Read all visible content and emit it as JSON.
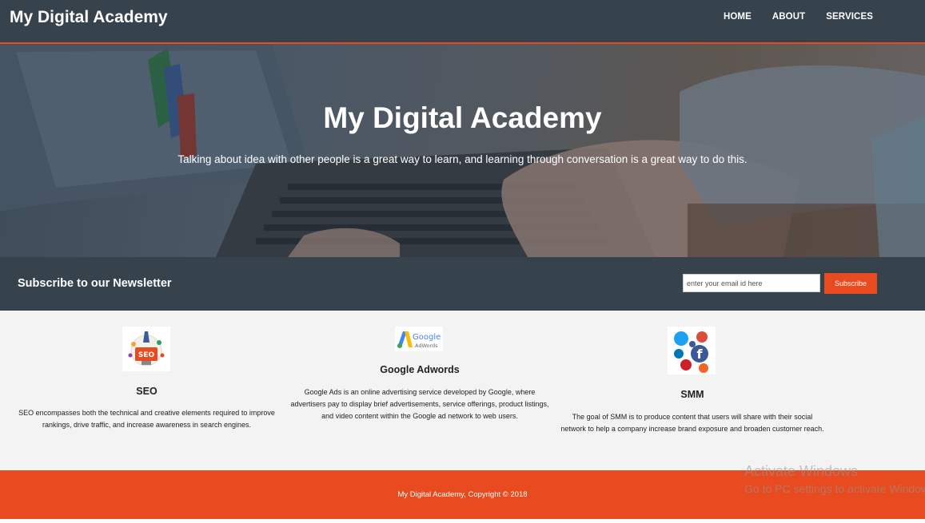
{
  "header": {
    "brand": "My Digital Academy",
    "nav": [
      "HOME",
      "ABOUT",
      "SERVICES"
    ]
  },
  "hero": {
    "title": "My Digital Academy",
    "subtitle": "Talking about idea with other people is a great way to learn, and learning through conversation is a great way to do this."
  },
  "newsletter": {
    "title": "Subscribe to our Newsletter",
    "email_placeholder": "enter your email id here",
    "button_label": "Subscribe"
  },
  "services": [
    {
      "logo_text": "SEO",
      "title": "SEO",
      "description": "SEO encompasses both the technical and creative elements required to improve rankings, drive traffic, and increase awareness in search engines."
    },
    {
      "logo_text": "Google",
      "logo_subtext": "AdWords",
      "title": "Google Adwords",
      "description": "Google Ads is an online advertising service developed by Google, where advertisers pay to display brief advertisements, service offerings, product listings, and video content within the Google ad network to web users."
    },
    {
      "title": "SMM",
      "description": "The goal of SMM is to produce content that users will share with their social network to help a company increase brand exposure and broaden customer reach."
    }
  ],
  "footer": {
    "text": "My Digital Academy, Copyright © 2018"
  },
  "watermark": {
    "line1": "Activate Windows",
    "line2": "Go to PC settings to activate Windows."
  },
  "colors": {
    "header_bg": "#37434c",
    "accent": "#e84b1f",
    "page_bg": "#f3f3f3"
  }
}
